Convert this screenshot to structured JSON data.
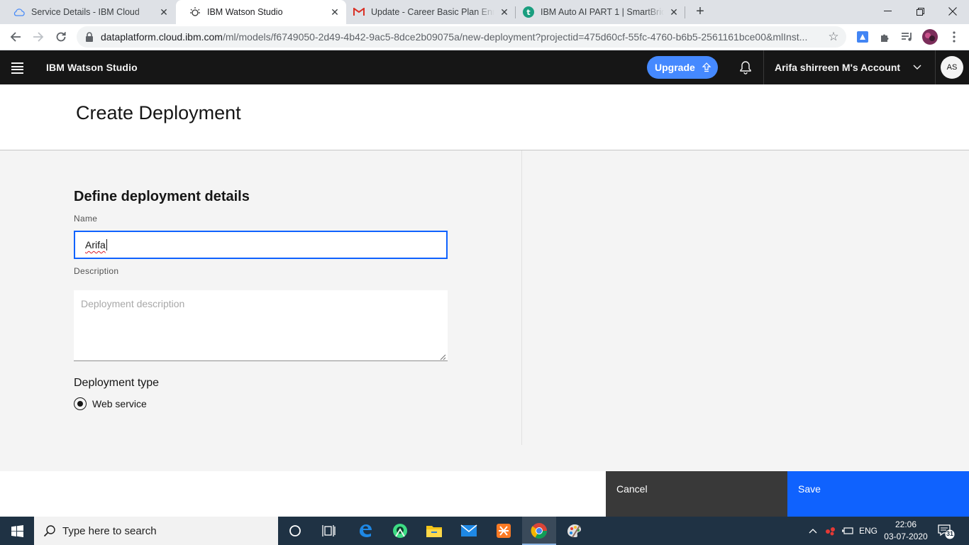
{
  "browser": {
    "tabs": [
      {
        "title": "Service Details - IBM Cloud",
        "icon": "cloud-icon"
      },
      {
        "title": "IBM Watson Studio",
        "icon": "watson-studio-icon"
      },
      {
        "title": "Update - Career Basic Plan Enroll",
        "icon": "gmail-icon"
      },
      {
        "title": "IBM Auto AI PART 1 | SmartBridge",
        "icon": "smartbridge-icon"
      }
    ],
    "url_host": "dataplatform.cloud.ibm.com",
    "url_path": "/ml/models/f6749050-2d49-4b42-9ac5-8dce2b09075a/new-deployment?projectid=475d60cf-55fc-4760-b6b5-2561161bce00&mlInst..."
  },
  "header": {
    "brand": "IBM Watson Studio",
    "upgrade_label": "Upgrade",
    "account": "Arifa shirreen M's Account",
    "avatar_initials": "AS"
  },
  "page": {
    "title": "Create Deployment",
    "section_title": "Define deployment details",
    "name_label": "Name",
    "name_value": "Arifa",
    "description_label": "Description",
    "description_placeholder": "Deployment description",
    "deployment_type_label": "Deployment type",
    "deployment_type_option": "Web service",
    "cancel_label": "Cancel",
    "save_label": "Save"
  },
  "taskbar": {
    "search_placeholder": "Type here to search",
    "language": "ENG",
    "time": "22:06",
    "date": "03-07-2020",
    "notification_count": "31"
  },
  "colors": {
    "ibm_blue": "#0f62fe",
    "upgrade_blue": "#4589ff",
    "header_bg": "#161616",
    "taskbar_bg": "#1f3244"
  }
}
